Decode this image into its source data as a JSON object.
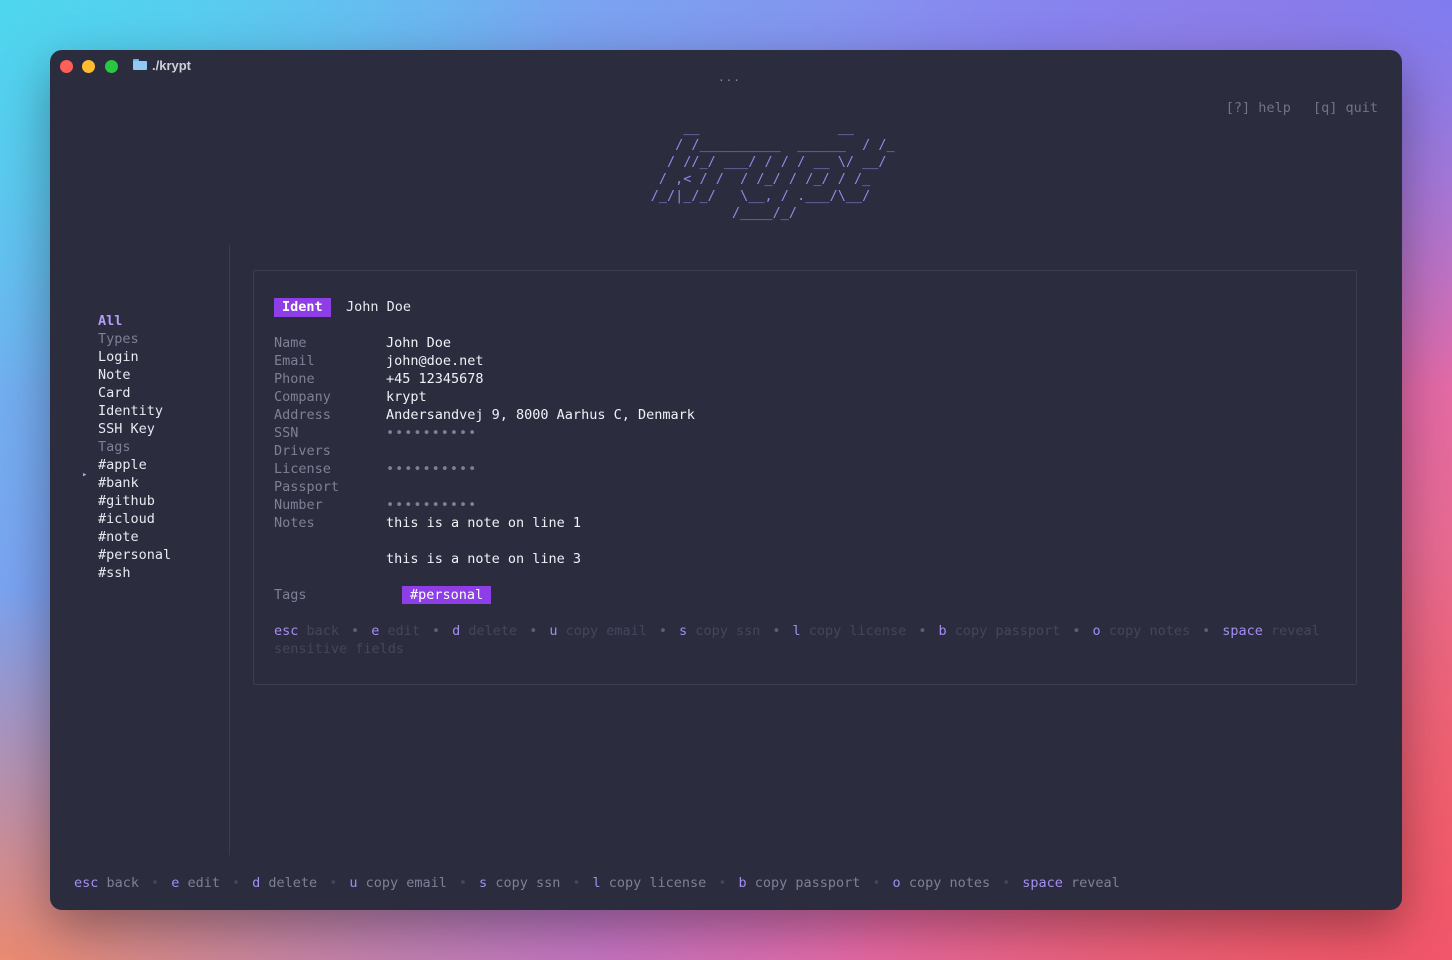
{
  "window": {
    "title": "./krypt"
  },
  "header": {
    "help": "[?] help",
    "quit": "[q] quit"
  },
  "logo_ascii": "          __                 __\n         / /__________  ______  / /_\n        / //_/ ___/ / / / __ \\/ __/\n       / ,< / /  / /_/ / /_/ / /_\n      /_/|_/_/   \\__, / .___/\\__/\n                /____/_/",
  "sidebar": {
    "items": [
      {
        "label": "All",
        "kind": "active"
      },
      {
        "label": "Types",
        "kind": "head"
      },
      {
        "label": "Login",
        "kind": "item"
      },
      {
        "label": "Note",
        "kind": "item"
      },
      {
        "label": "Card",
        "kind": "item"
      },
      {
        "label": "Identity",
        "kind": "item"
      },
      {
        "label": "SSH Key",
        "kind": "item"
      },
      {
        "label": "Tags",
        "kind": "head"
      },
      {
        "label": "#apple",
        "kind": "item"
      },
      {
        "label": "#bank",
        "kind": "item"
      },
      {
        "label": "#github",
        "kind": "item"
      },
      {
        "label": "#icloud",
        "kind": "item"
      },
      {
        "label": "#note",
        "kind": "item"
      },
      {
        "label": "#personal",
        "kind": "item"
      },
      {
        "label": "#ssh",
        "kind": "item"
      }
    ]
  },
  "entry": {
    "type_badge": "Ident",
    "title": "John Doe",
    "fields": [
      {
        "label": "Name",
        "value": "John Doe"
      },
      {
        "label": "Email",
        "value": "john@doe.net"
      },
      {
        "label": "Phone",
        "value": "+45 12345678"
      },
      {
        "label": "Company",
        "value": "krypt"
      },
      {
        "label": "Address",
        "value": "Andersandvej 9, 8000 Aarhus C, Denmark"
      },
      {
        "label": "SSN",
        "value": "••••••••••",
        "masked": true
      },
      {
        "label": "Drivers",
        "value": ""
      },
      {
        "label": "License",
        "value": "••••••••••",
        "masked": true
      },
      {
        "label": "Passport",
        "value": ""
      },
      {
        "label": "Number",
        "value": "••••••••••",
        "masked": true
      },
      {
        "label": "Notes",
        "value": "this is a note on line 1"
      },
      {
        "label": "",
        "value": ""
      },
      {
        "label": "",
        "value": "this is a note on line 3"
      }
    ],
    "tags_label": "Tags",
    "tags": [
      "#personal"
    ]
  },
  "card_hints": [
    {
      "key": "esc",
      "action": "back"
    },
    {
      "key": "e",
      "action": "edit"
    },
    {
      "key": "d",
      "action": "delete"
    },
    {
      "key": "u",
      "action": "copy email"
    },
    {
      "key": "s",
      "action": "copy ssn"
    },
    {
      "key": "l",
      "action": "copy license"
    },
    {
      "key": "b",
      "action": "copy passport"
    },
    {
      "key": "o",
      "action": "copy notes"
    },
    {
      "key": "space",
      "action": "reveal sensitive fields"
    }
  ],
  "footer_hints": [
    {
      "key": "esc",
      "action": "back"
    },
    {
      "key": "e",
      "action": "edit"
    },
    {
      "key": "d",
      "action": "delete"
    },
    {
      "key": "u",
      "action": "copy email"
    },
    {
      "key": "s",
      "action": "copy ssn"
    },
    {
      "key": "l",
      "action": "copy license"
    },
    {
      "key": "b",
      "action": "copy passport"
    },
    {
      "key": "o",
      "action": "copy notes"
    },
    {
      "key": "space",
      "action": "reveal"
    }
  ],
  "colors": {
    "accent": "#8d3ee6",
    "accent_text": "#b69cf7",
    "window_bg": "#2b2c3e"
  }
}
